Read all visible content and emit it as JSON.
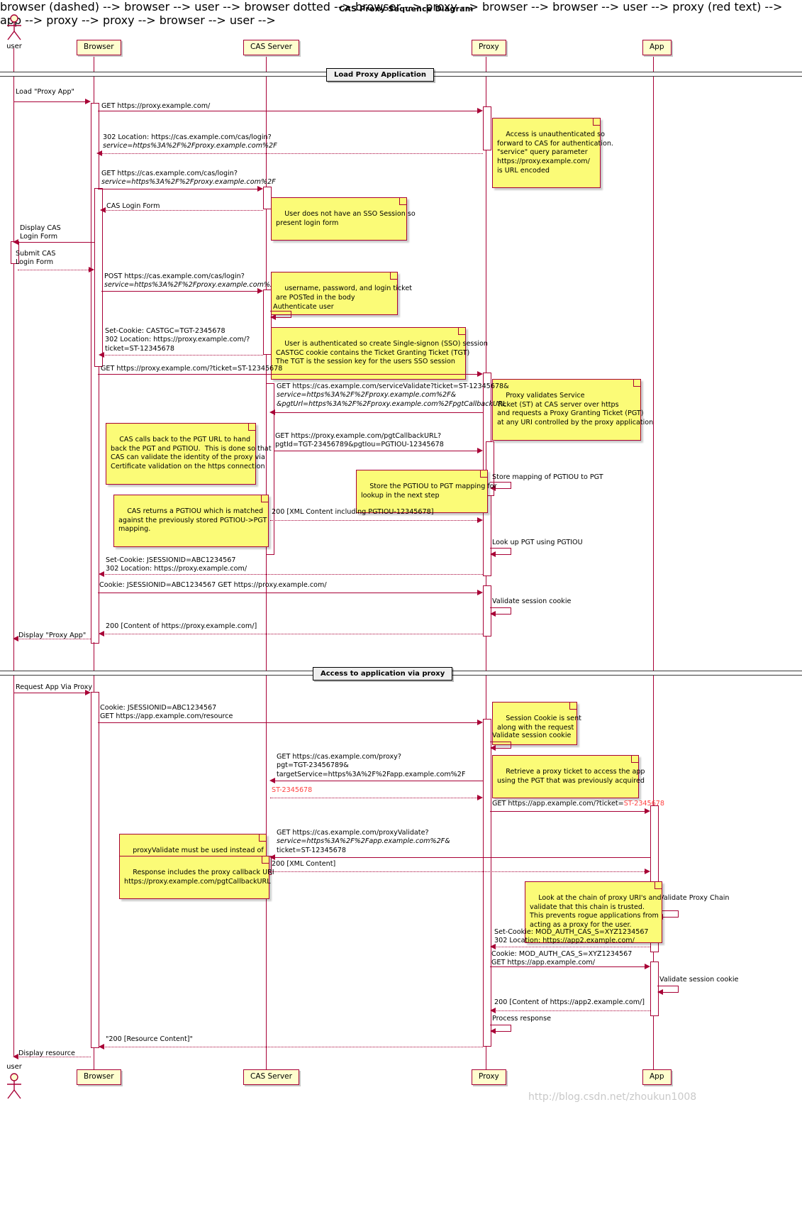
{
  "title": "CAS Proxy Sequence Diagram",
  "watermark": "http://blog.csdn.net/zhoukun1008",
  "colors": {
    "participant_fill": "#FEFECE",
    "participant_border": "#A80036",
    "note_fill": "#FBFB77",
    "line": "#A80036",
    "divider_label_fill": "#EEEEEE",
    "highlight_red": "#FF4040"
  },
  "actors": {
    "top_label": "user",
    "bottom_label": "user"
  },
  "participants": [
    {
      "name": "browser",
      "label": "Browser"
    },
    {
      "name": "cas-server",
      "label": "CAS Server"
    },
    {
      "name": "proxy",
      "label": "Proxy"
    },
    {
      "name": "app",
      "label": "App"
    }
  ],
  "dividers": [
    {
      "name": "load-proxy-application",
      "label": "Load Proxy Application"
    },
    {
      "name": "access-to-application-via-proxy",
      "label": "Access to application via proxy"
    }
  ],
  "messages": [
    {
      "id": "m1",
      "text": "Load \"Proxy App\""
    },
    {
      "id": "m2",
      "text": "GET https://proxy.example.com/"
    },
    {
      "id": "m3",
      "line1": "302 Location: https://cas.example.com/cas/login?",
      "line2": "service=https%3A%2F%2Fproxy.example.com%2F"
    },
    {
      "id": "m4",
      "line1": "GET https://cas.example.com/cas/login?",
      "line2": "service=https%3A%2F%2Fproxy.example.com%2F"
    },
    {
      "id": "m5",
      "text": "CAS Login Form"
    },
    {
      "id": "m6",
      "line1": "Display CAS",
      "line2": "Login Form"
    },
    {
      "id": "m7",
      "line1": "Submit CAS",
      "line2": "Login Form"
    },
    {
      "id": "m8",
      "line1": "POST https://cas.example.com/cas/login?",
      "line2": "service=https%3A%2F%2Fproxy.example.com%2F"
    },
    {
      "id": "m9",
      "text": "Authenticate user"
    },
    {
      "id": "m10",
      "line1": "Set-Cookie: CASTGC=TGT-2345678",
      "line2": "302 Location: https://proxy.example.com/?",
      "line3": "ticket=ST-12345678"
    },
    {
      "id": "m11",
      "text": "GET https://proxy.example.com/?ticket=ST-12345678"
    },
    {
      "id": "m12",
      "line1": "GET https://cas.example.com/serviceValidate?ticket=ST-12345678&",
      "line2": "service=https%3A%2F%2Fproxy.example.com%2F&",
      "line3": "&pgtUrl=https%3A%2F%2Fproxy.example.com%2FpgtCallbackURL"
    },
    {
      "id": "m13",
      "line1": "GET https://proxy.example.com/pgtCallbackURL?",
      "line2": "pgtId=TGT-23456789&pgtIou=PGTIOU-12345678"
    },
    {
      "id": "m14",
      "text": "Store mapping of PGTIOU to PGT"
    },
    {
      "id": "m15",
      "text": "200 [XML Content including PGTIOU-12345678]"
    },
    {
      "id": "m16",
      "text": "Look up PGT using PGTIOU"
    },
    {
      "id": "m17",
      "line1": "Set-Cookie: JSESSIONID=ABC1234567",
      "line2": "302 Location: https://proxy.example.com/"
    },
    {
      "id": "m18",
      "text": "Cookie: JSESSIONID=ABC1234567 GET https://proxy.example.com/"
    },
    {
      "id": "m19",
      "text": "Validate session cookie"
    },
    {
      "id": "m20",
      "text": "200 [Content of https://proxy.example.com/]"
    },
    {
      "id": "m21",
      "text": "Display \"Proxy App\""
    },
    {
      "id": "m22",
      "text": "Request App Via Proxy"
    },
    {
      "id": "m23",
      "line1": "Cookie: JSESSIONID=ABC1234567",
      "line2": "GET https://app.example.com/resource"
    },
    {
      "id": "m24",
      "text": "Validate session cookie"
    },
    {
      "id": "m25",
      "line1": "GET https://cas.example.com/proxy?",
      "line2": "pgt=TGT-23456789&",
      "line3": "targetService=https%3A%2F%2Fapp.example.com%2F"
    },
    {
      "id": "m26",
      "text": "ST-2345678"
    },
    {
      "id": "m27",
      "prefix": "GET https://app.example.com/?ticket=",
      "ticket": "ST-2345678"
    },
    {
      "id": "m28",
      "line1": "GET https://cas.example.com/proxyValidate?",
      "line2": "service=https%3A%2F%2Fapp.example.com%2F&",
      "line3": "ticket=ST-12345678"
    },
    {
      "id": "m29",
      "text": "200 [XML Content]"
    },
    {
      "id": "m30",
      "text": "Validate Proxy Chain"
    },
    {
      "id": "m31",
      "line1": "Set-Cookie: MOD_AUTH_CAS_S=XYZ1234567",
      "line2": "302 Location: https://app2.example.com/"
    },
    {
      "id": "m32",
      "line1": "Cookie: MOD_AUTH_CAS_S=XYZ1234567",
      "line2": "GET https://app.example.com/"
    },
    {
      "id": "m33",
      "text": "Validate session cookie"
    },
    {
      "id": "m34",
      "text": "200 [Content of https://app2.example.com/]"
    },
    {
      "id": "m35",
      "text": "Process response"
    },
    {
      "id": "m36",
      "text": "\"200 [Resource Content]\""
    },
    {
      "id": "m37",
      "text": "Display resource"
    }
  ],
  "notes": [
    {
      "id": "n1",
      "text": "Access is unauthenticated so\nforward to CAS for authentication.\n\"service\" query parameter\nhttps://proxy.example.com/\nis URL encoded"
    },
    {
      "id": "n2",
      "text": "User does not have an SSO Session so\npresent login form"
    },
    {
      "id": "n3",
      "text": "username, password, and login ticket\nare POSTed in the body"
    },
    {
      "id": "n4",
      "text": "User is authenticated so create Single-signon (SSO) session\nCASTGC cookie contains the Ticket Granting Ticket (TGT)\nThe TGT is the session key for the users SSO session"
    },
    {
      "id": "n5",
      "text": "Proxy validates Service\nTicket (ST) at CAS server over https\nand requests a Proxy Granting Ticket (PGT)\nat any URI controlled by the proxy application"
    },
    {
      "id": "n6",
      "text": "CAS calls back to the PGT URL to hand\nback the PGT and PGTIOU.  This is done so that\nCAS can validate the identity of the proxy via\nCertificate validation on the https connection"
    },
    {
      "id": "n7",
      "text": "Store the PGTIOU to PGT mapping for\nlookup in the next step"
    },
    {
      "id": "n8",
      "text": "CAS returns a PGTIOU which is matched\nagainst the previously stored PGTIOU->PGT\nmapping."
    },
    {
      "id": "n9",
      "text": "Session Cookie is sent\nalong with the request"
    },
    {
      "id": "n10",
      "text": "Retrieve a proxy ticket to access the app\nusing the PGT that was previously acquired"
    },
    {
      "id": "n11",
      "text": "proxyValidate must be used instead of\nserviceValidate to validate a proxy\nticket"
    },
    {
      "id": "n12",
      "text": "Response includes the proxy callback URI\nhttps://proxy.example.com/pgtCallbackURL"
    },
    {
      "id": "n13",
      "text": "Look at the chain of proxy URI's and\nvalidate that this chain is trusted.\nThis prevents rogue applications from\nacting as a proxy for the user."
    }
  ]
}
